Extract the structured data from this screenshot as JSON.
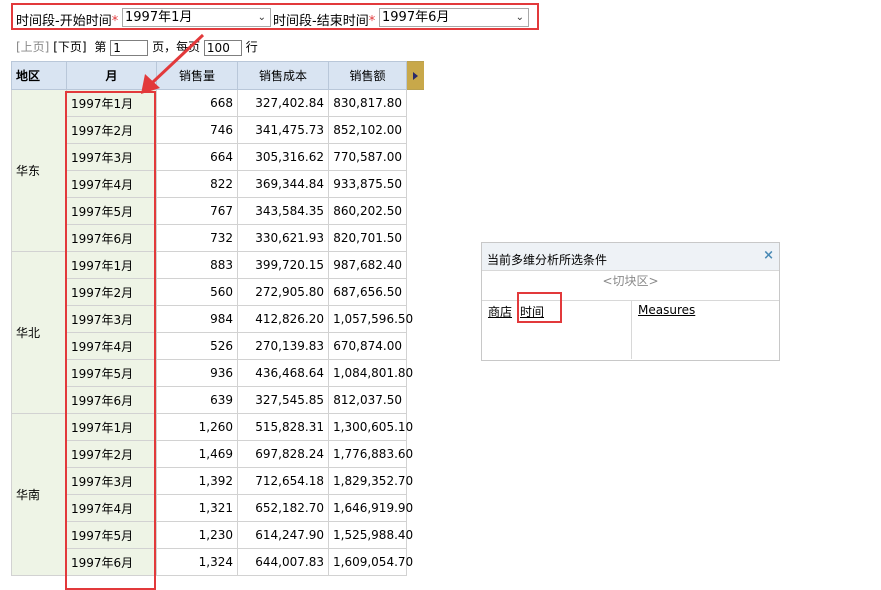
{
  "filter": {
    "start_label": "时间段-开始时间",
    "start_required": "*",
    "start_value": "1997年1月",
    "end_label": "时间段-结束时间",
    "end_required": "*",
    "end_value": "1997年6月"
  },
  "pager": {
    "prev": "[上页]",
    "next": "[下页]",
    "page_prefix": "第",
    "page_value": "1",
    "page_suffix": "页，每页",
    "per_page_value": "100",
    "per_page_suffix": "行"
  },
  "table": {
    "headers": {
      "region": "地区",
      "month": "月",
      "qty": "销售量",
      "cost": "销售成本",
      "amount": "销售额"
    },
    "groups": [
      {
        "region": "华东",
        "rows": [
          {
            "month": "1997年1月",
            "qty": "668",
            "cost": "327,402.84",
            "amount": "830,817.80"
          },
          {
            "month": "1997年2月",
            "qty": "746",
            "cost": "341,475.73",
            "amount": "852,102.00"
          },
          {
            "month": "1997年3月",
            "qty": "664",
            "cost": "305,316.62",
            "amount": "770,587.00"
          },
          {
            "month": "1997年4月",
            "qty": "822",
            "cost": "369,344.84",
            "amount": "933,875.50"
          },
          {
            "month": "1997年5月",
            "qty": "767",
            "cost": "343,584.35",
            "amount": "860,202.50"
          },
          {
            "month": "1997年6月",
            "qty": "732",
            "cost": "330,621.93",
            "amount": "820,701.50"
          }
        ]
      },
      {
        "region": "华北",
        "rows": [
          {
            "month": "1997年1月",
            "qty": "883",
            "cost": "399,720.15",
            "amount": "987,682.40"
          },
          {
            "month": "1997年2月",
            "qty": "560",
            "cost": "272,905.80",
            "amount": "687,656.50"
          },
          {
            "month": "1997年3月",
            "qty": "984",
            "cost": "412,826.20",
            "amount": "1,057,596.50"
          },
          {
            "month": "1997年4月",
            "qty": "526",
            "cost": "270,139.83",
            "amount": "670,874.00"
          },
          {
            "month": "1997年5月",
            "qty": "936",
            "cost": "436,468.64",
            "amount": "1,084,801.80"
          },
          {
            "month": "1997年6月",
            "qty": "639",
            "cost": "327,545.85",
            "amount": "812,037.50"
          }
        ]
      },
      {
        "region": "华南",
        "rows": [
          {
            "month": "1997年1月",
            "qty": "1,260",
            "cost": "515,828.31",
            "amount": "1,300,605.10"
          },
          {
            "month": "1997年2月",
            "qty": "1,469",
            "cost": "697,828.24",
            "amount": "1,776,883.60"
          },
          {
            "month": "1997年3月",
            "qty": "1,392",
            "cost": "712,654.18",
            "amount": "1,829,352.70"
          },
          {
            "month": "1997年4月",
            "qty": "1,321",
            "cost": "652,182.70",
            "amount": "1,646,919.90"
          },
          {
            "month": "1997年5月",
            "qty": "1,230",
            "cost": "614,247.90",
            "amount": "1,525,988.40"
          },
          {
            "month": "1997年6月",
            "qty": "1,324",
            "cost": "644,007.83",
            "amount": "1,609,054.70"
          }
        ]
      }
    ]
  },
  "panel": {
    "title": "当前多维分析所选条件",
    "close": "×",
    "slice": "<切块区>",
    "dim_store": "商店",
    "dim_time": "时间",
    "measures": "Measures"
  },
  "colors": {
    "highlight": "#e2393b",
    "header_bg": "#d9e4f2",
    "dim_bg": "#eef4e6"
  }
}
